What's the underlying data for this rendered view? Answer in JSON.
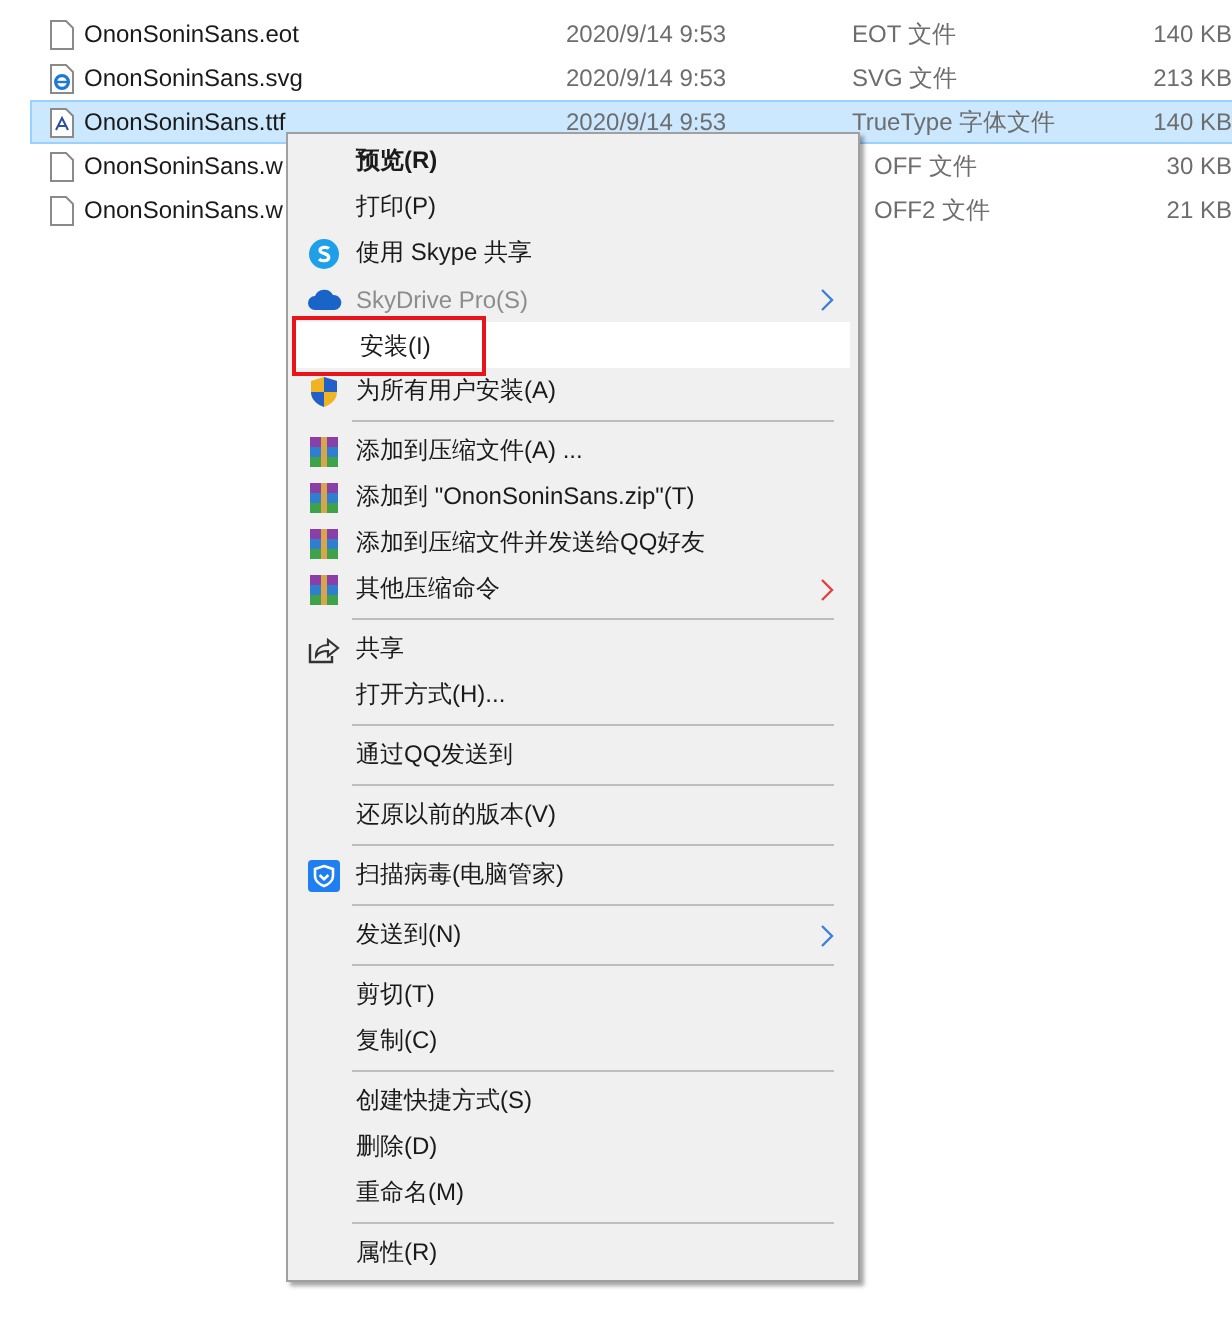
{
  "files": [
    {
      "kind": "blank",
      "name": "OnonSoninSans.eot",
      "date": "2020/9/14 9:53",
      "type": "EOT 文件",
      "size": "140 KB",
      "selected": false,
      "covered": false
    },
    {
      "kind": "svg",
      "name": "OnonSoninSans.svg",
      "date": "2020/9/14 9:53",
      "type": "SVG 文件",
      "size": "213 KB",
      "selected": false,
      "covered": false
    },
    {
      "kind": "font",
      "name": "OnonSoninSans.ttf",
      "date": "2020/9/14 9:53",
      "type": "TrueType 字体文件",
      "size": "140 KB",
      "selected": true,
      "covered": false
    },
    {
      "kind": "blank",
      "name": "OnonSoninSans.w",
      "type": "OFF 文件",
      "size": "30 KB",
      "selected": false,
      "covered": true
    },
    {
      "kind": "blank",
      "name": "OnonSoninSans.w",
      "type": "OFF2 文件",
      "size": "21 KB",
      "selected": false,
      "covered": true
    }
  ],
  "context_menu": [
    {
      "kind": "plain",
      "label": "预览(R)",
      "bold": true
    },
    {
      "kind": "plain",
      "label": "打印(P)"
    },
    {
      "kind": "skype",
      "label": "使用 Skype 共享"
    },
    {
      "kind": "cloud",
      "label": "SkyDrive Pro(S)",
      "disabled": true,
      "submenu": true
    },
    {
      "kind": "plain",
      "label": "安装(I)",
      "highlighted": true,
      "marked": true
    },
    {
      "kind": "shield",
      "label": "为所有用户安装(A)"
    },
    {
      "kind": "separator"
    },
    {
      "kind": "archive",
      "label": "添加到压缩文件(A) ..."
    },
    {
      "kind": "archive",
      "label": "添加到 \"OnonSoninSans.zip\"(T)"
    },
    {
      "kind": "archive",
      "label": "添加到压缩文件并发送给QQ好友"
    },
    {
      "kind": "archive",
      "label": "其他压缩命令",
      "submenu": true
    },
    {
      "kind": "separator"
    },
    {
      "kind": "share",
      "label": "共享"
    },
    {
      "kind": "plain",
      "label": "打开方式(H)..."
    },
    {
      "kind": "separator"
    },
    {
      "kind": "plain",
      "label": "通过QQ发送到"
    },
    {
      "kind": "separator"
    },
    {
      "kind": "plain",
      "label": "还原以前的版本(V)"
    },
    {
      "kind": "separator"
    },
    {
      "kind": "guard",
      "label": "扫描病毒(电脑管家)"
    },
    {
      "kind": "separator"
    },
    {
      "kind": "plain",
      "label": "发送到(N)",
      "submenu": true
    },
    {
      "kind": "separator"
    },
    {
      "kind": "plain",
      "label": "剪切(T)"
    },
    {
      "kind": "plain",
      "label": "复制(C)"
    },
    {
      "kind": "separator"
    },
    {
      "kind": "plain",
      "label": "创建快捷方式(S)"
    },
    {
      "kind": "plain",
      "label": "删除(D)"
    },
    {
      "kind": "plain",
      "label": "重命名(M)"
    },
    {
      "kind": "separator"
    },
    {
      "kind": "plain",
      "label": "属性(R)"
    }
  ]
}
